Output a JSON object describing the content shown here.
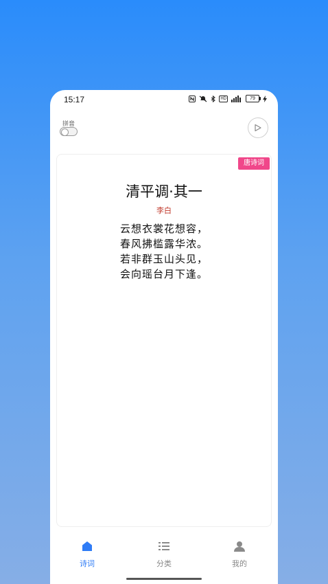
{
  "status_bar": {
    "time": "15:17",
    "icons": [
      "nfc-icon",
      "mute-icon",
      "bluetooth-icon",
      "hd-icon",
      "signal-icon"
    ],
    "hd_label": "HD",
    "battery": "79"
  },
  "toolbar": {
    "pinyin_label": "拼音",
    "pinyin_enabled": false
  },
  "poem": {
    "tag": "唐诗词",
    "title": "清平调·其一",
    "author": "李白",
    "lines": [
      "云想衣裳花想容，",
      "春风拂槛露华浓。",
      "若非群玉山头见，",
      "会向瑶台月下逢。"
    ]
  },
  "tabs": [
    {
      "label": "诗词",
      "icon": "home-icon",
      "active": true
    },
    {
      "label": "分类",
      "icon": "list-icon",
      "active": false
    },
    {
      "label": "我的",
      "icon": "user-icon",
      "active": false
    }
  ],
  "colors": {
    "accent": "#2f7cf6",
    "tag": "#f0478a",
    "author": "#c0392b"
  }
}
